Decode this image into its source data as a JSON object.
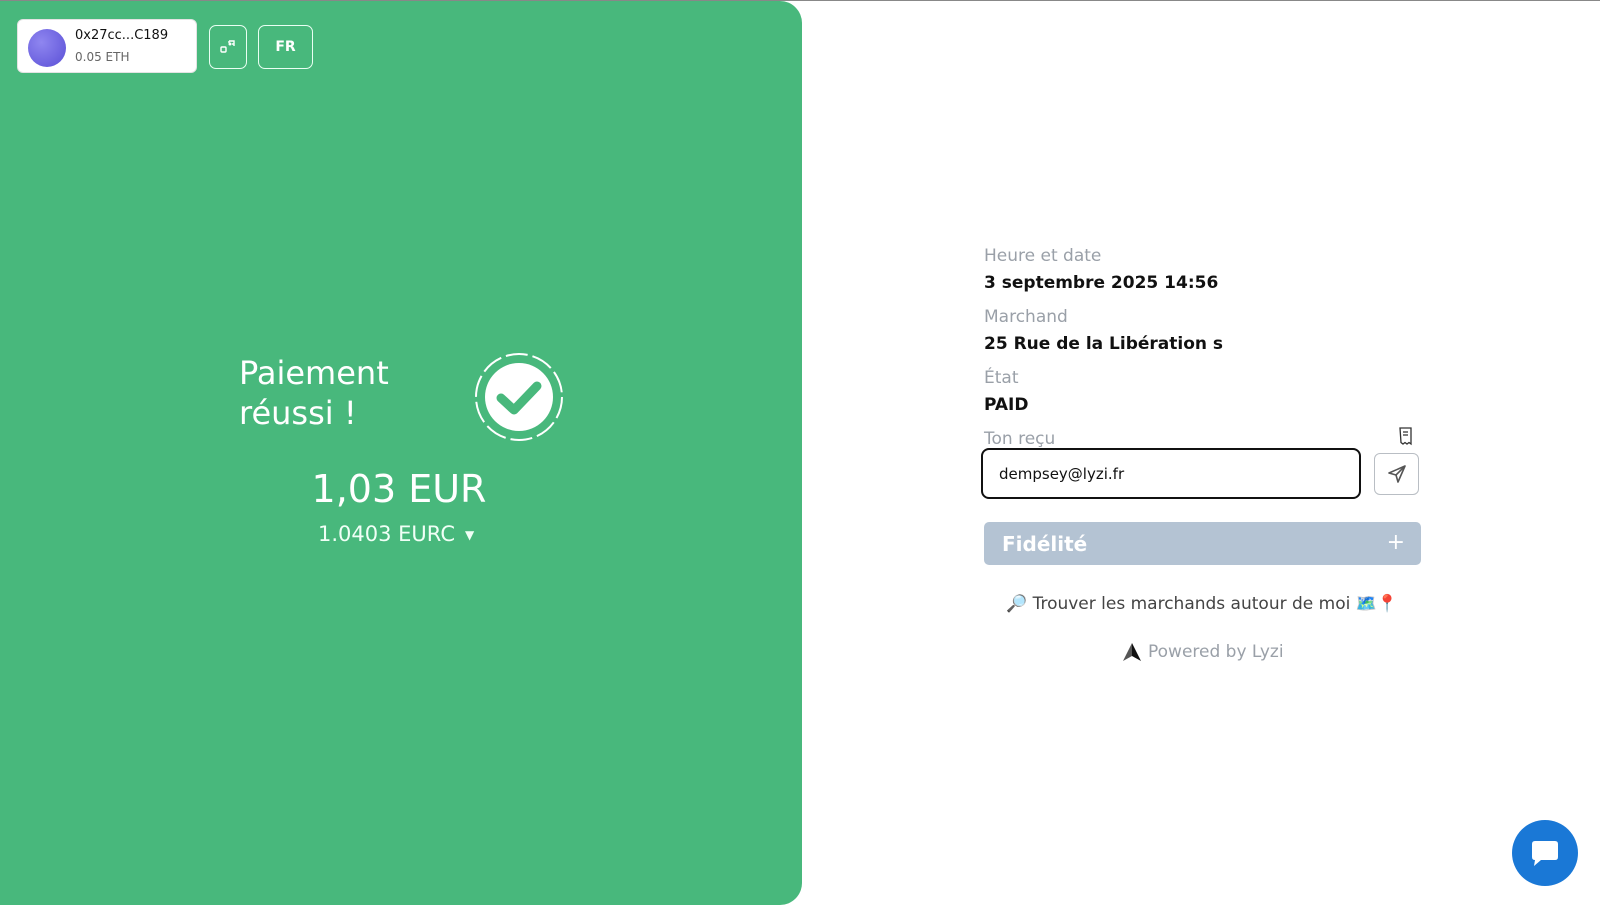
{
  "wallet": {
    "address": "0x27cc...C189",
    "balance": "0.05 ETH"
  },
  "header": {
    "lang_label": "FR"
  },
  "payment": {
    "title_line1": "Paiement",
    "title_line2": "réussi !",
    "amount": "1,03 EUR",
    "crypto_amount": "1.0403 EURC"
  },
  "details": {
    "datetime_label": "Heure et date",
    "datetime_value": "3 septembre 2025 14:56",
    "merchant_label": "Marchand",
    "merchant_value": "25 Rue de la Libération s",
    "state_label": "État",
    "state_value": "PAID",
    "receipt_label": "Ton reçu"
  },
  "receipt": {
    "email_value": "dempsey@lyzi.fr"
  },
  "fidelity": {
    "label": "Fidélité",
    "plus": "+"
  },
  "links": {
    "find_merchants": "🔎 Trouver les marchands autour de moi 🗺️📍",
    "powered_by": "Powered by Lyzi"
  },
  "colors": {
    "panel": "#48b87c",
    "chat": "#1a78d6",
    "fidelity": "#b4c3d3"
  }
}
